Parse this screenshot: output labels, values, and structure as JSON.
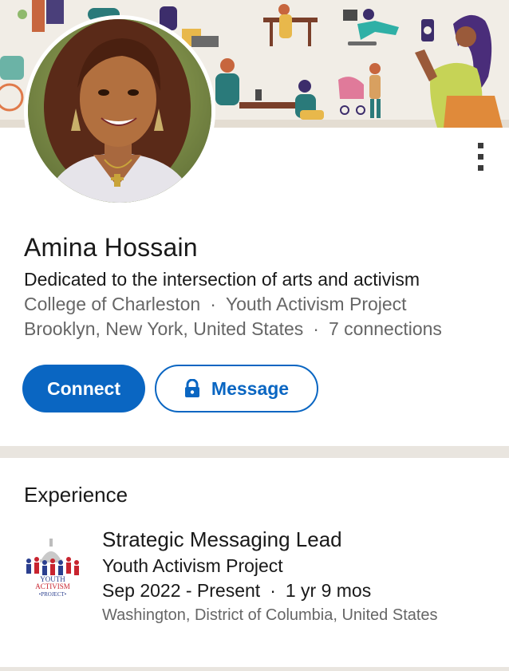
{
  "profile": {
    "name": "Amina Hossain",
    "headline": "Dedicated to the intersection of arts and activism",
    "school": "College of Charleston",
    "company": "Youth Activism Project",
    "location": "Brooklyn, New York, United States",
    "connections": "7 connections",
    "separator": "·"
  },
  "actions": {
    "connect_label": "Connect",
    "message_label": "Message"
  },
  "experience": {
    "section_title": "Experience",
    "items": [
      {
        "title": "Strategic Messaging Lead",
        "company": "Youth Activism Project",
        "dates": "Sep 2022 - Present",
        "duration": "1 yr 9 mos",
        "location": "Washington, District of Columbia, United States",
        "logo_text": {
          "line1": "YOUTH",
          "line2": "ACTIVISM",
          "line3": "•PROJECT•"
        }
      }
    ]
  },
  "colors": {
    "primary": "#0a66c2",
    "text": "#191919",
    "muted": "#666666",
    "divider": "#e9e5df"
  },
  "icons": {
    "more": "more-vertical-icon",
    "lock": "lock-icon"
  }
}
